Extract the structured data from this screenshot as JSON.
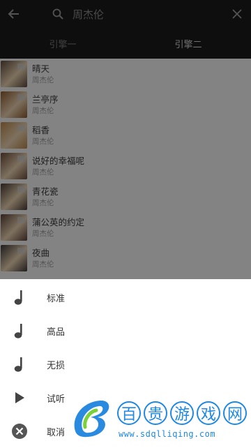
{
  "toolbar": {
    "query": "周杰伦"
  },
  "tabs": [
    {
      "label": "引擎一",
      "active": false
    },
    {
      "label": "引擎二",
      "active": true
    }
  ],
  "songs": [
    {
      "title": "晴天",
      "artist": "周杰伦",
      "cover": "#5b4a3a"
    },
    {
      "title": "兰亭序",
      "artist": "周杰伦",
      "cover": "#8c5a2e"
    },
    {
      "title": "稻香",
      "artist": "周杰伦",
      "cover": "#b9864a"
    },
    {
      "title": "说好的幸福呢",
      "artist": "周杰伦",
      "cover": "#6a4b3a"
    },
    {
      "title": "青花瓷",
      "artist": "周杰伦",
      "cover": "#4a3a33"
    },
    {
      "title": "蒲公英的约定",
      "artist": "周杰伦",
      "cover": "#5a3f35"
    },
    {
      "title": "夜曲",
      "artist": "周杰伦",
      "cover": "#3a3636"
    }
  ],
  "sheet": {
    "options": [
      {
        "label": "标准",
        "icon": "music-note-icon"
      },
      {
        "label": "高品",
        "icon": "music-note-icon"
      },
      {
        "label": "无损",
        "icon": "music-note-icon"
      },
      {
        "label": "试听",
        "icon": "play-icon"
      },
      {
        "label": "取消",
        "icon": "cancel-circle-icon"
      }
    ]
  },
  "watermark": {
    "text": "百贵游戏网",
    "url": "www.sdqlliqing.com"
  },
  "colors": {
    "toolbar": "#1a1a1a",
    "accent": "#1e88e5"
  }
}
